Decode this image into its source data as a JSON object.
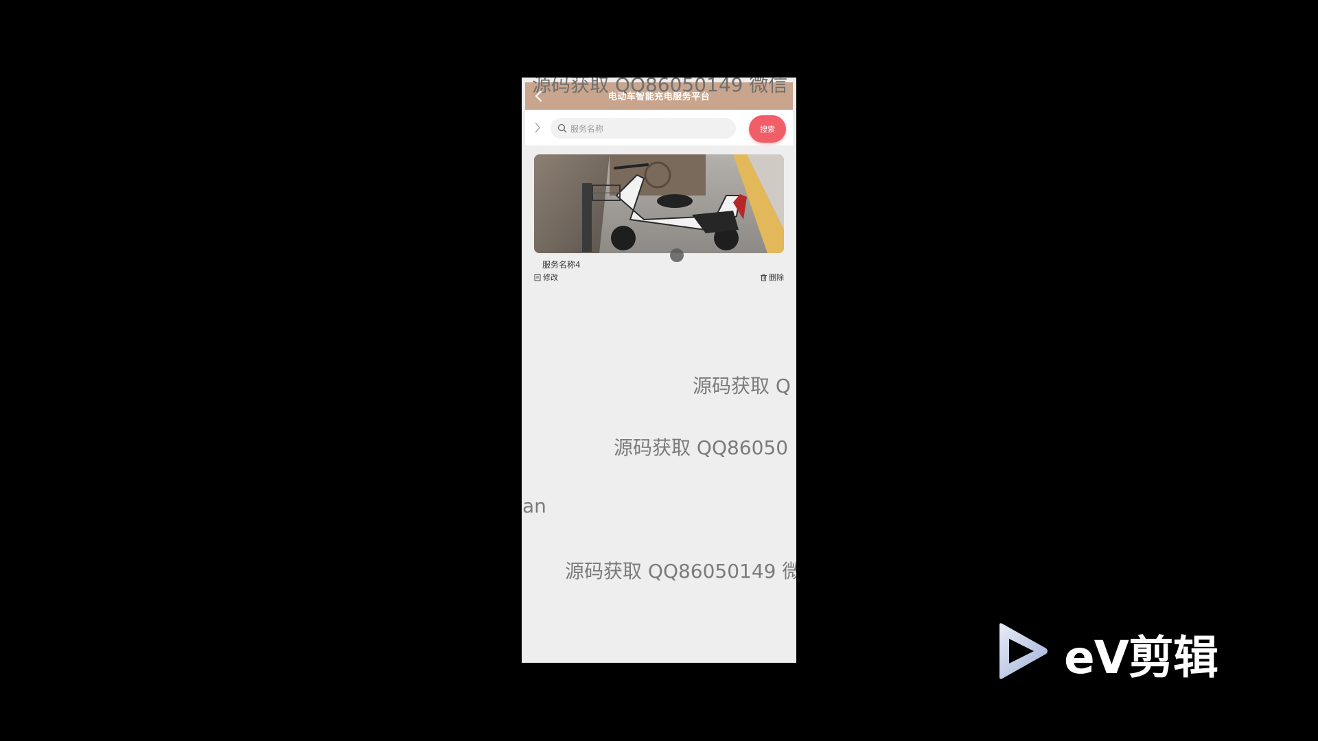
{
  "header": {
    "title": "电动车智能充电服务平台",
    "watermark_top": "源码获取 QQ86050149 微信"
  },
  "search": {
    "placeholder": "服务名称",
    "value": "",
    "button_label": "搜索"
  },
  "items": [
    {
      "name": "服务名称4",
      "edit_label": "修改",
      "delete_label": "删除",
      "image": "electric-scooter-photo"
    }
  ],
  "watermarks": [
    "源码获取 Q",
    "源码获取 QQ86050",
    "an",
    "源码获取 QQ86050149 微"
  ],
  "overlay": {
    "brand_text": "eV剪辑"
  },
  "colors": {
    "header_bg": "#c9a58d",
    "search_button": "#f05e68",
    "page_bg": "#eeeeee",
    "outer_bg": "#000000"
  }
}
